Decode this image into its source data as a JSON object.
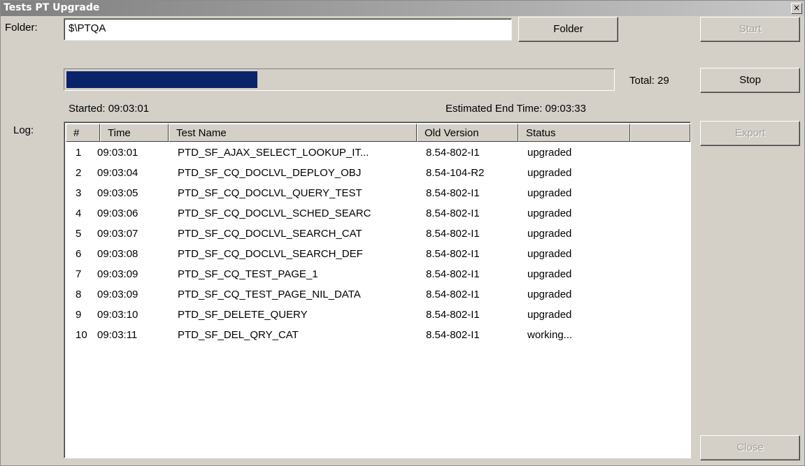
{
  "window": {
    "title": "Tests PT Upgrade",
    "close_glyph": "×"
  },
  "folder": {
    "label": "Folder:",
    "value": "$\\PTQA",
    "button_label": "Folder"
  },
  "buttons": {
    "start": "Start",
    "stop": "Stop",
    "export": "Export",
    "close": "Close"
  },
  "progress": {
    "fraction": 0.35,
    "total_label": "Total: 29"
  },
  "status": {
    "started": "Started: 09:03:01",
    "estimated_end": "Estimated End Time: 09:03:33"
  },
  "log": {
    "label": "Log:",
    "columns": [
      "#",
      "Time",
      "Test Name",
      "Old Version",
      "Status",
      ""
    ],
    "rows": [
      {
        "num": "1",
        "time": "09:03:01",
        "name": "PTD_SF_AJAX_SELECT_LOOKUP_IT...",
        "version": "8.54-802-I1",
        "status": "upgraded"
      },
      {
        "num": "2",
        "time": "09:03:04",
        "name": "PTD_SF_CQ_DOCLVL_DEPLOY_OBJ",
        "version": "8.54-104-R2",
        "status": "upgraded"
      },
      {
        "num": "3",
        "time": "09:03:05",
        "name": "PTD_SF_CQ_DOCLVL_QUERY_TEST",
        "version": "8.54-802-I1",
        "status": "upgraded"
      },
      {
        "num": "4",
        "time": "09:03:06",
        "name": "PTD_SF_CQ_DOCLVL_SCHED_SEARC",
        "version": "8.54-802-I1",
        "status": "upgraded"
      },
      {
        "num": "5",
        "time": "09:03:07",
        "name": "PTD_SF_CQ_DOCLVL_SEARCH_CAT",
        "version": "8.54-802-I1",
        "status": "upgraded"
      },
      {
        "num": "6",
        "time": "09:03:08",
        "name": "PTD_SF_CQ_DOCLVL_SEARCH_DEF",
        "version": "8.54-802-I1",
        "status": "upgraded"
      },
      {
        "num": "7",
        "time": "09:03:09",
        "name": "PTD_SF_CQ_TEST_PAGE_1",
        "version": "8.54-802-I1",
        "status": "upgraded"
      },
      {
        "num": "8",
        "time": "09:03:09",
        "name": "PTD_SF_CQ_TEST_PAGE_NIL_DATA",
        "version": "8.54-802-I1",
        "status": "upgraded"
      },
      {
        "num": "9",
        "time": "09:03:10",
        "name": "PTD_SF_DELETE_QUERY",
        "version": "8.54-802-I1",
        "status": "upgraded"
      },
      {
        "num": "10",
        "time": "09:03:11",
        "name": "PTD_SF_DEL_QRY_CAT",
        "version": "8.54-802-I1",
        "status": "working..."
      }
    ]
  }
}
